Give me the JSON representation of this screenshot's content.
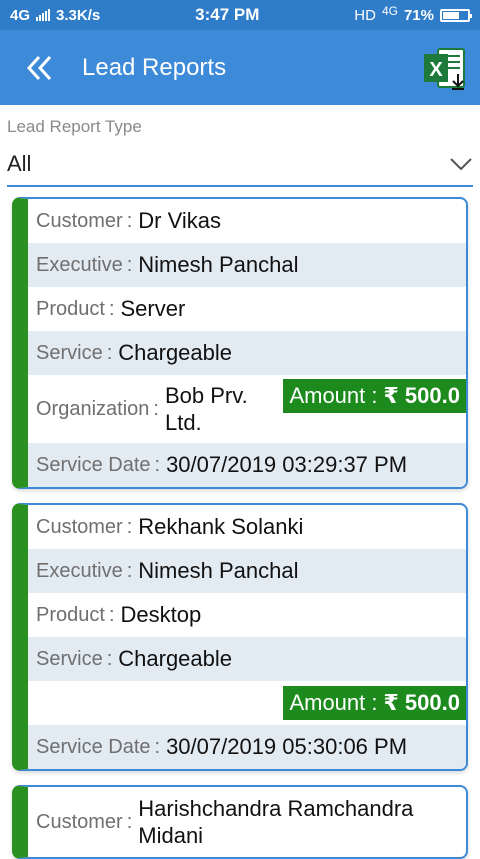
{
  "status_bar": {
    "network": "4G",
    "speed": "3.3K/s",
    "time": "3:47 PM",
    "hd": "HD",
    "net2": "4G",
    "battery": "71%",
    "battery_level": 0.71
  },
  "app_bar": {
    "title": "Lead Reports",
    "back_icon": "double-chevron-left-icon",
    "export_icon": "excel-download-icon"
  },
  "filter": {
    "label": "Lead Report Type",
    "value": "All"
  },
  "labels": {
    "customer": "Customer",
    "executive": "Executive",
    "product": "Product",
    "service": "Service",
    "organization": "Organization",
    "amount": "Amount",
    "service_date": "Service Date",
    "colon": ":"
  },
  "cards": [
    {
      "customer": "Dr Vikas",
      "executive": "Nimesh Panchal",
      "product": "Server",
      "service": "Chargeable",
      "organization": "Bob Prv. Ltd.",
      "amount": "₹ 500.0",
      "service_date": "30/07/2019 03:29:37 PM"
    },
    {
      "customer": "Rekhank Solanki",
      "executive": "Nimesh Panchal",
      "product": "Desktop",
      "service": "Chargeable",
      "amount": "₹ 500.0",
      "service_date": "30/07/2019 05:30:06 PM"
    },
    {
      "customer": "Harishchandra Ramchandra Midani"
    }
  ]
}
